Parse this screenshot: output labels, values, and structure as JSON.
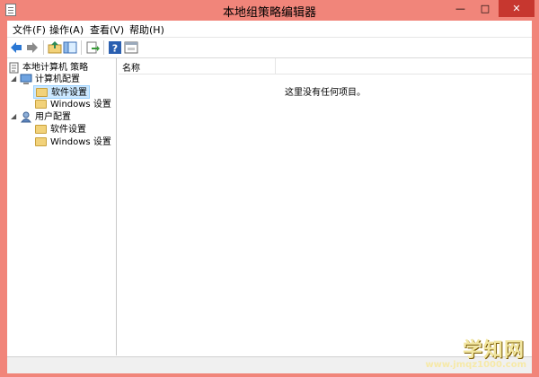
{
  "window": {
    "title": "本地组策略编辑器",
    "controls": {
      "minimize": "—",
      "maximize": "□",
      "close": "✕"
    }
  },
  "menubar": {
    "items": [
      {
        "label": "文件(F)"
      },
      {
        "label": "操作(A)"
      },
      {
        "label": "查看(V)"
      },
      {
        "label": "帮助(H)"
      }
    ]
  },
  "toolbar": {
    "buttons": [
      {
        "icon": "back-arrow-icon"
      },
      {
        "icon": "forward-arrow-icon"
      },
      {
        "icon": "up-folder-icon"
      },
      {
        "icon": "show-hide-tree-icon"
      },
      {
        "icon": "export-list-icon"
      },
      {
        "icon": "help-icon"
      },
      {
        "icon": "properties-icon"
      }
    ]
  },
  "tree": {
    "root": {
      "label": "本地计算机 策略"
    },
    "computer_config": {
      "label": "计算机配置",
      "children": [
        {
          "label": "软件设置",
          "selected": true
        },
        {
          "label": "Windows 设置"
        }
      ]
    },
    "user_config": {
      "label": "用户配置",
      "children": [
        {
          "label": "软件设置"
        },
        {
          "label": "Windows 设置"
        }
      ]
    }
  },
  "detail": {
    "column_header": "名称",
    "empty_message": "这里没有任何项目。"
  },
  "watermark": {
    "text": "学知网",
    "url": "www.jmqz1000.com"
  },
  "colors": {
    "frame": "#f1857a",
    "close_button": "#c7372f",
    "selection": "#cce8ff",
    "folder": "#f2d27a"
  }
}
